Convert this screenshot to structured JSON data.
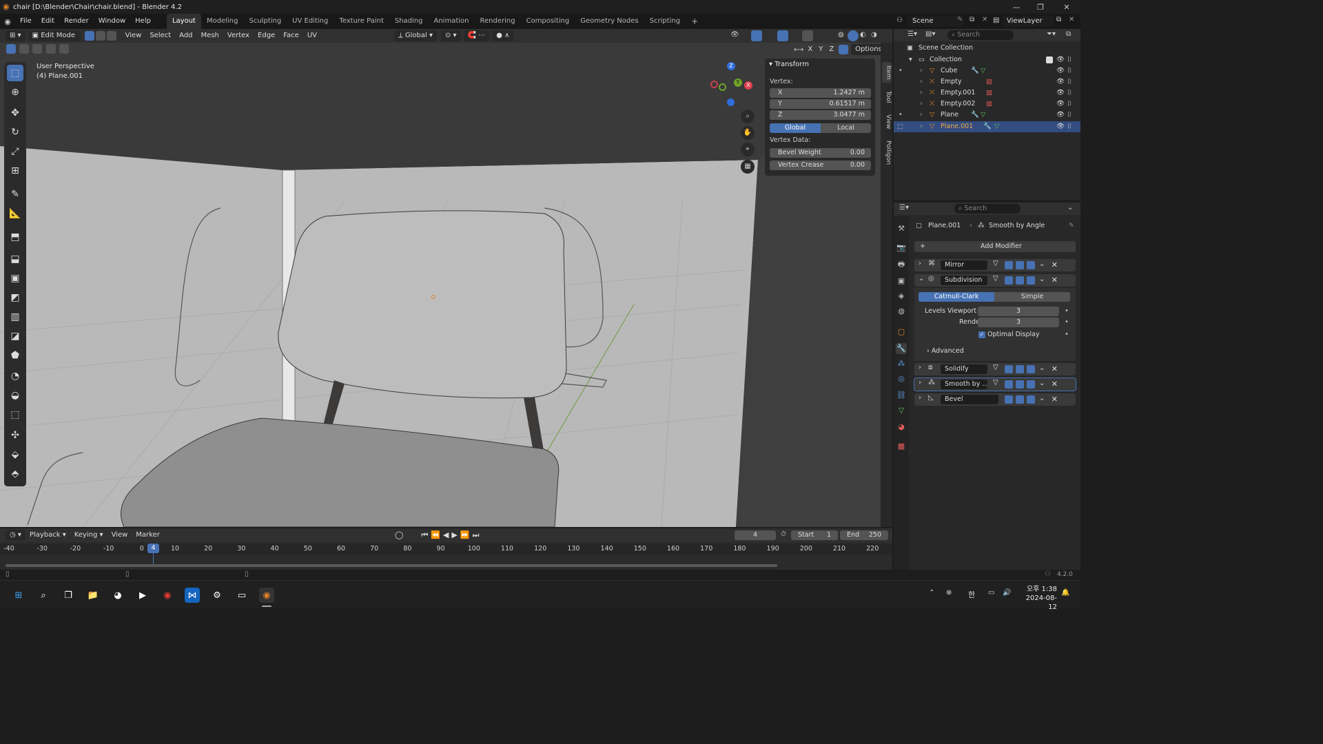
{
  "window": {
    "title": "chair [D:\\Blender\\Chair\\chair.blend] - Blender 4.2",
    "min": "—",
    "max": "❐",
    "close": "✕"
  },
  "menus": [
    "File",
    "Edit",
    "Render",
    "Window",
    "Help"
  ],
  "workspaces": [
    "Layout",
    "Modeling",
    "Sculpting",
    "UV Editing",
    "Texture Paint",
    "Shading",
    "Animation",
    "Rendering",
    "Compositing",
    "Geometry Nodes",
    "Scripting"
  ],
  "workspace_add": "+",
  "scene": {
    "scene_name": "Scene",
    "view_layer": "ViewLayer"
  },
  "viewport_header": {
    "mode": "Edit Mode",
    "menus": [
      "View",
      "Select",
      "Add",
      "Mesh",
      "Vertex",
      "Edge",
      "Face",
      "UV"
    ],
    "orientation": "Global",
    "axes": [
      "X",
      "Y",
      "Z"
    ],
    "options": "Options"
  },
  "viewport": {
    "perspective": "User Perspective",
    "object": "(4) Plane.001",
    "gizmo_axes": [
      "Z",
      "Y",
      "X"
    ]
  },
  "n_panel": {
    "header": "Transform",
    "vertex_label": "Vertex:",
    "x_label": "X",
    "x_value": "1.2427 m",
    "y_label": "Y",
    "y_value": "0.61517 m",
    "z_label": "Z",
    "z_value": "3.0477 m",
    "global": "Global",
    "local": "Local",
    "vertex_data_label": "Vertex Data:",
    "bevel_weight_label": "Bevel Weight",
    "bevel_weight_value": "0.00",
    "vertex_crease_label": "Vertex Crease",
    "vertex_crease_value": "0.00"
  },
  "n_tabs": [
    "Item",
    "Tool",
    "View",
    "Polligon"
  ],
  "outliner": {
    "search_placeholder": "Search",
    "scene_collection": "Scene Collection",
    "collection": "Collection",
    "items": [
      {
        "name": "Cube"
      },
      {
        "name": "Empty"
      },
      {
        "name": "Empty.001"
      },
      {
        "name": "Empty.002"
      },
      {
        "name": "Plane"
      },
      {
        "name": "Plane.001"
      }
    ]
  },
  "properties": {
    "search_placeholder": "Search",
    "object": "Plane.001",
    "modifier_path": "Smooth by Angle",
    "add_modifier": "Add Modifier",
    "modifiers": [
      {
        "name": "Mirror"
      },
      {
        "name": "Subdivision"
      },
      {
        "name": "Solidify"
      },
      {
        "name": "Smooth by ..."
      },
      {
        "name": "Bevel"
      }
    ],
    "subdivision": {
      "catmull": "Catmull-Clark",
      "simple": "Simple",
      "levels_viewport_label": "Levels Viewport",
      "levels_viewport_value": "3",
      "render_label": "Render",
      "render_value": "3",
      "optimal_display": "Optimal Display",
      "advanced": "Advanced"
    }
  },
  "timeline": {
    "menus": [
      "Playback",
      "Keying",
      "View",
      "Marker"
    ],
    "current_frame": "4",
    "start_label": "Start",
    "start_value": "1",
    "end_label": "End",
    "end_value": "250",
    "ticks": [
      "-40",
      "-30",
      "-20",
      "-10",
      "0",
      "10",
      "20",
      "30",
      "40",
      "50",
      "60",
      "70",
      "80",
      "90",
      "100",
      "110",
      "120",
      "130",
      "140",
      "150",
      "160",
      "170",
      "180",
      "190",
      "200",
      "210",
      "220"
    ]
  },
  "status": {
    "version": "4.2.0"
  },
  "taskbar": {
    "time": "오후 1:38",
    "date": "2024-08-12",
    "ime": "한"
  },
  "colors": {
    "accent": "#4772b3",
    "header": "#303030",
    "panel": "#282828",
    "viewport": "#3d3d3d",
    "selected_row": "#334d80",
    "orange": "#e0822a"
  }
}
